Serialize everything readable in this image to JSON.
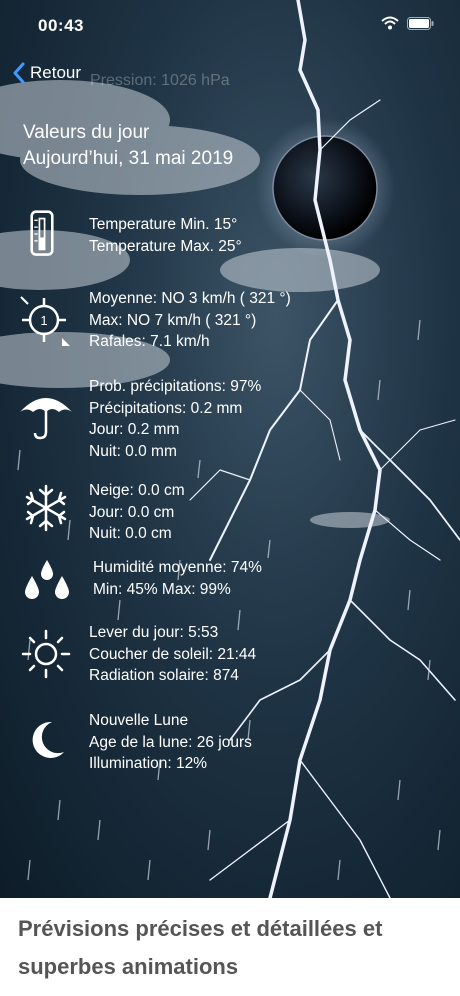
{
  "status": {
    "time": "00:43"
  },
  "nav": {
    "back_label": "Retour"
  },
  "pressure": "Pression: 1026 hPa",
  "header": {
    "title": "Valeurs du jour",
    "date": "Aujourd’hui, 31 mai 2019"
  },
  "temperature": {
    "min": "Temperature Min. 15°",
    "max": "Temperature Max. 25°"
  },
  "wind": {
    "avg": "Moyenne: NO 3 km/h ( 321 °)",
    "max": "Max: NO 7 km/h ( 321 °)",
    "gusts": "Rafales: 7.1 km/h",
    "icon_number": "1"
  },
  "precip": {
    "prob": "Prob. précipitations: 97%",
    "amount": "Précipitations: 0.2 mm",
    "day": "Jour: 0.2 mm",
    "night": "Nuit: 0.0 mm"
  },
  "snow": {
    "amount": "Neige: 0.0 cm",
    "day": "Jour: 0.0 cm",
    "night": "Nuit: 0.0 cm"
  },
  "humidity": {
    "avg": "Humidité moyenne: 74%",
    "range": "Min: 45%  Max: 99%"
  },
  "sun": {
    "rise": "Lever du jour: 5:53",
    "set": "Coucher de soleil: 21:44",
    "radiation": "Radiation solaire: 874"
  },
  "moon": {
    "phase": "Nouvelle Lune",
    "age": "Age de la lune: 26 jours",
    "illumination": "Illumination: 12%"
  },
  "caption": "Prévisions précises et détaillées et superbes animations"
}
